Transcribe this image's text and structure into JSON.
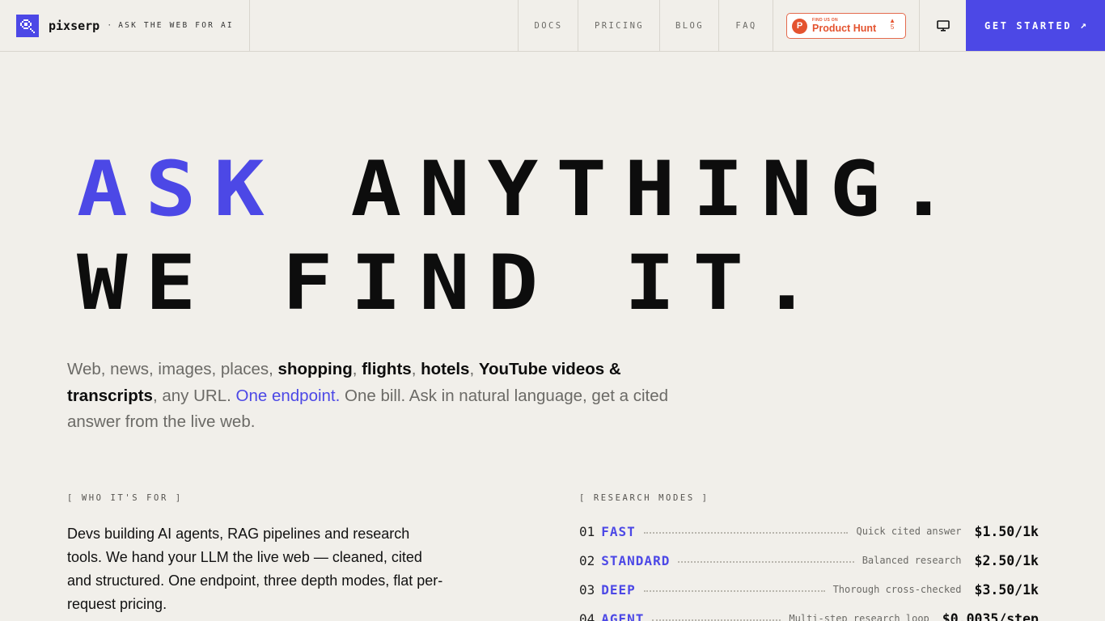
{
  "colors": {
    "accent": "#4c48e6",
    "background": "#f1efea",
    "product_hunt": "#e4532f"
  },
  "header": {
    "brand": {
      "name": "pixserp",
      "separator": "·",
      "tagline": "ASK THE WEB FOR AI",
      "logo_icon": "magnifier-pixel-icon"
    },
    "nav": [
      "DOCS",
      "PRICING",
      "BLOG",
      "FAQ"
    ],
    "product_hunt": {
      "letter": "P",
      "small": "FIND US ON",
      "name": "Product Hunt",
      "arrow": "▲",
      "votes": "5"
    },
    "theme_toggle_icon": "monitor-icon",
    "cta": {
      "label": "GET STARTED",
      "arrow": "↗"
    }
  },
  "hero": {
    "line1": {
      "accent": "ASK",
      "rest": " ANYTHING."
    },
    "line2": "WE FIND IT."
  },
  "lede": {
    "t1": "Web, news, images, places, ",
    "b1": "shopping",
    "t2": ", ",
    "b2": "flights",
    "t3": ", ",
    "b3": "hotels",
    "t4": ", ",
    "b4": "YouTube videos & transcripts",
    "t5": ", any URL. ",
    "link": "One endpoint.",
    "t6": " One bill. Ask in natural language, get a cited answer from the live web."
  },
  "who": {
    "label": "[ WHO IT'S FOR ]",
    "body": "Devs building AI agents, RAG pipelines and research tools. We hand your LLM the live web — cleaned, cited and structured. One endpoint, three depth modes, flat per-request pricing."
  },
  "modes": {
    "label": "[ RESEARCH MODES ]",
    "items": [
      {
        "num": "01",
        "name": "FAST",
        "desc": "Quick cited answer",
        "price": "$1.50/1k"
      },
      {
        "num": "02",
        "name": "STANDARD",
        "desc": "Balanced research",
        "price": "$2.50/1k"
      },
      {
        "num": "03",
        "name": "DEEP",
        "desc": "Thorough cross-checked",
        "price": "$3.50/1k"
      },
      {
        "num": "04",
        "name": "AGENT",
        "desc": "Multi-step research loop",
        "price": "$0.0035/step"
      }
    ]
  }
}
